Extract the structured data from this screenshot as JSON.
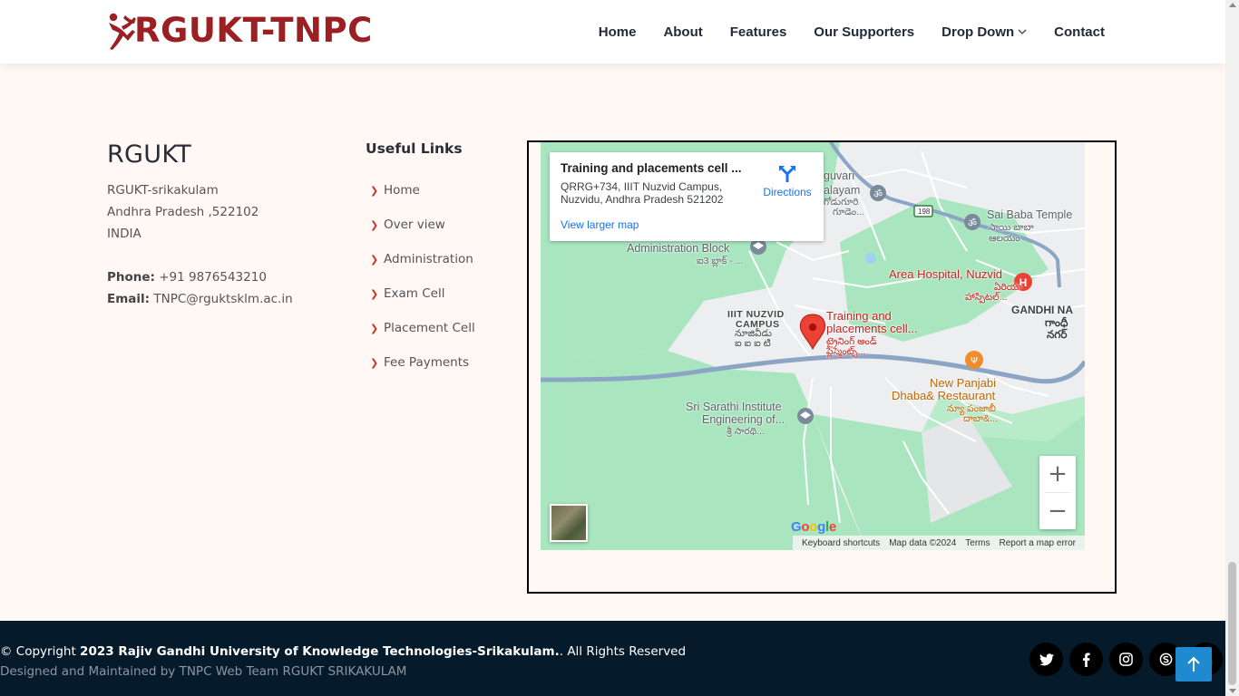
{
  "brand": {
    "name": "RGUKT-TNPC",
    "color": "#9b1f23"
  },
  "nav": {
    "items": [
      {
        "label": "Home"
      },
      {
        "label": "About"
      },
      {
        "label": "Features"
      },
      {
        "label": "Our Supporters"
      },
      {
        "label": "Drop Down",
        "icon": "chevron-down-icon"
      },
      {
        "label": "Contact"
      }
    ]
  },
  "contact": {
    "title": "RGUKT",
    "address_line1": "RGUKT-srikakulam",
    "address_line2": "Andhra Pradesh ,522102",
    "address_line3": "INDIA",
    "phone_label": "Phone:",
    "phone": " +91 9876543210",
    "email_label": "Email:",
    "email": " TNPC@rguktsklm.ac.in"
  },
  "useful_links": {
    "title": "Useful Links",
    "items": [
      "Home",
      "Over view",
      "Administration",
      "Exam Cell",
      "Placement Cell",
      "Fee Payments"
    ]
  },
  "map": {
    "place_title": "Training and placements cell ...",
    "address_line1": "QRRG+734, IIIT Nuzvid Campus,",
    "address_line2": "Nuzvidu, Andhra Pradesh 521202",
    "directions": "Directions",
    "view_larger": "View larger map",
    "labels": {
      "guvari": "guvari",
      "alayam": "alayam",
      "guvari_te": "గోడుగూరి",
      "gudem_te": "గూడెం...",
      "sai_baba": "Sai Baba Temple",
      "sai_baba_te1": "సాయి బాబా",
      "sai_baba_te2": "ఆలయం",
      "admin_block": "Administration Block",
      "admin_block_te": "ఐ3 బ్లాక్ - ...",
      "area_hospital": "Area Hospital, Nuzvid",
      "area_hospital_te1": "ఏరియా",
      "area_hospital_te2": "హాస్పిటల్...",
      "gandhi": "GANDHI NA",
      "gandhi_te1": "గాంధీ",
      "gandhi_te2": "నగర్",
      "campus1": "IIIT NUZVID",
      "campus2": "CAMPUS",
      "campus_te1": "నూజివీడు",
      "campus_te2": "ఐ ఐ ఐ టి",
      "tpc1": "Training and",
      "tpc2": "placements cell...",
      "tpc_te1": "ట్రైనింగ్ అండ్",
      "tpc_te2": "ప్లేస్మెంట్స్...",
      "panjabi1": "New Panjabi",
      "panjabi2": "Dhaba& Restaurant",
      "panjabi_te1": "న్యూ పంజాబీ",
      "panjabi_te2": "దాబా&...",
      "sarathi1": "Sri Sarathi Institute",
      "sarathi2": "Engineering of...",
      "sarathi_te": "శ్రీ సారథి...",
      "road_badge": "198"
    },
    "google": "Google",
    "attribution": {
      "shortcuts": "Keyboard shortcuts",
      "data": "Map data ©2024",
      "terms": "Terms",
      "report": "Report a map error"
    },
    "zoom_in": "+",
    "zoom_out": "−"
  },
  "footer": {
    "copyright_prefix": "© Copyright ",
    "copyright_org": "2023 Rajiv Gandhi University of Knowledge Technologies-Srikakulam.",
    "copyright_suffix": ". All Rights Reserved",
    "credit": "Designed and Maintained by TNPC Web Team RGUKT SRIKAKULAM",
    "social": [
      "twitter-icon",
      "facebook-icon",
      "instagram-icon",
      "skype-icon",
      "linkedin-icon"
    ]
  },
  "colors": {
    "accent": "#c0392b",
    "footer_bg": "#051b2c",
    "back_to_top": "#1f8ad0"
  }
}
